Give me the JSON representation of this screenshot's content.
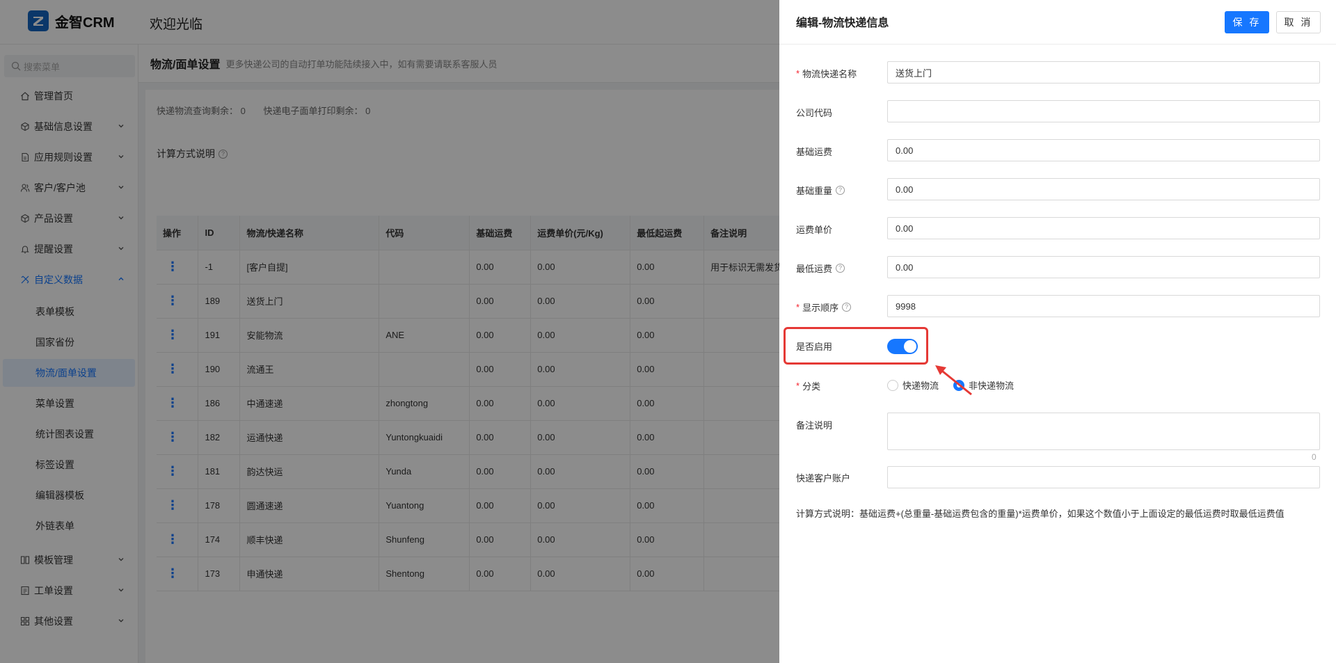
{
  "app": {
    "name": "金智CRM",
    "welcome": "欢迎光临"
  },
  "sidebar": {
    "search_placeholder": "搜索菜单",
    "items": [
      {
        "label": "管理首页"
      },
      {
        "label": "基础信息设置"
      },
      {
        "label": "应用规则设置"
      },
      {
        "label": "客户/客户池"
      },
      {
        "label": "产品设置"
      },
      {
        "label": "提醒设置"
      },
      {
        "label": "自定义数据"
      },
      {
        "label": "模板管理"
      },
      {
        "label": "工单设置"
      },
      {
        "label": "其他设置"
      }
    ],
    "sub_items": [
      {
        "label": "表单模板"
      },
      {
        "label": "国家省份"
      },
      {
        "label": "物流/面单设置"
      },
      {
        "label": "菜单设置"
      },
      {
        "label": "统计图表设置"
      },
      {
        "label": "标签设置"
      },
      {
        "label": "编辑器模板"
      },
      {
        "label": "外链表单"
      }
    ]
  },
  "page": {
    "title": "物流/面单设置",
    "desc": "更多快递公司的自动打单功能陆续接入中，如有需要请联系客服人员",
    "stat1": "快递物流查询剩余： 0",
    "stat2": "快递电子面单打印剩余： 0",
    "calc_label": "计算方式说明"
  },
  "table": {
    "headers": [
      "操作",
      "ID",
      "物流/快递名称",
      "代码",
      "基础运费",
      "运费单价(元/Kg)",
      "最低起运费",
      "备注说明"
    ],
    "rows": [
      {
        "op": "⋮",
        "id": "-1",
        "name": "[客户自提]",
        "code": "",
        "base": "0.00",
        "unit": "0.00",
        "min": "0.00",
        "note": "用于标识无需发货"
      },
      {
        "op": "⋮",
        "id": "189",
        "name": "送货上门",
        "code": "",
        "base": "0.00",
        "unit": "0.00",
        "min": "0.00",
        "note": ""
      },
      {
        "op": "⋮",
        "id": "191",
        "name": "安能物流",
        "code": "ANE",
        "base": "0.00",
        "unit": "0.00",
        "min": "0.00",
        "note": ""
      },
      {
        "op": "⋮",
        "id": "190",
        "name": "流通王",
        "code": "",
        "base": "0.00",
        "unit": "0.00",
        "min": "0.00",
        "note": ""
      },
      {
        "op": "⋮",
        "id": "186",
        "name": "中通速递",
        "code": "zhongtong",
        "base": "0.00",
        "unit": "0.00",
        "min": "0.00",
        "note": ""
      },
      {
        "op": "⋮",
        "id": "182",
        "name": "运通快递",
        "code": "Yuntongkuaidi",
        "base": "0.00",
        "unit": "0.00",
        "min": "0.00",
        "note": ""
      },
      {
        "op": "⋮",
        "id": "181",
        "name": "韵达快运",
        "code": "Yunda",
        "base": "0.00",
        "unit": "0.00",
        "min": "0.00",
        "note": ""
      },
      {
        "op": "⋮",
        "id": "178",
        "name": "圆通速递",
        "code": "Yuantong",
        "base": "0.00",
        "unit": "0.00",
        "min": "0.00",
        "note": ""
      },
      {
        "op": "⋮",
        "id": "174",
        "name": "顺丰快递",
        "code": "Shunfeng",
        "base": "0.00",
        "unit": "0.00",
        "min": "0.00",
        "note": ""
      },
      {
        "op": "⋮",
        "id": "173",
        "name": "申通快递",
        "code": "Shentong",
        "base": "0.00",
        "unit": "0.00",
        "min": "0.00",
        "note": ""
      }
    ]
  },
  "drawer": {
    "title": "编辑-物流快递信息",
    "save": "保 存",
    "cancel": "取 消",
    "fields": {
      "name_label": "物流快递名称",
      "name_value": "送货上门",
      "code_label": "公司代码",
      "code_value": "",
      "base_fee_label": "基础运费",
      "base_fee_value": "0.00",
      "base_weight_label": "基础重量",
      "base_weight_value": "0.00",
      "unit_price_label": "运费单价",
      "unit_price_value": "0.00",
      "min_fee_label": "最低运费",
      "min_fee_value": "0.00",
      "order_label": "显示顺序",
      "order_value": "9998",
      "enabled_label": "是否启用",
      "enabled": true,
      "category_label": "分类",
      "category_options": [
        "快递物流",
        "非快递物流"
      ],
      "category_selected": "非快递物流",
      "remark_label": "备注说明",
      "remark_count": "0",
      "account_label": "快递客户账户",
      "account_value": ""
    },
    "note": "计算方式说明：基础运费+(总重量-基础运费包含的重量)*运费单价，如果这个数值小于上面设定的最低运费时取最低运费值"
  },
  "colors": {
    "accent": "#1677ff",
    "highlight": "#e53935",
    "overlay": "rgba(0,0,0,0.45)"
  }
}
